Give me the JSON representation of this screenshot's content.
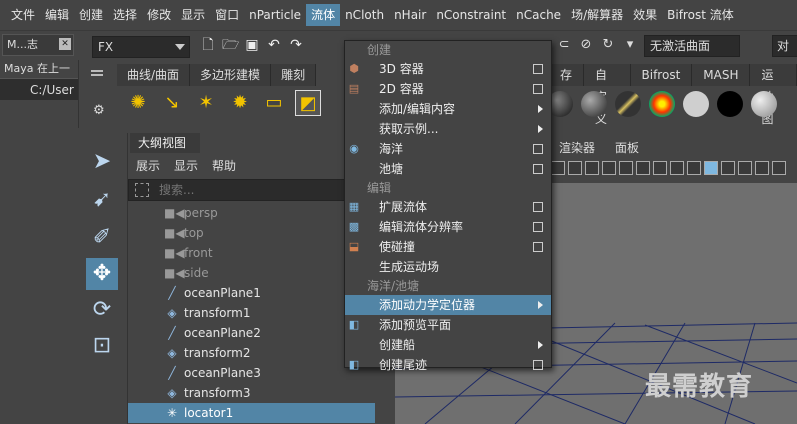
{
  "menubar": {
    "items": [
      "文件",
      "编辑",
      "创建",
      "选择",
      "修改",
      "显示",
      "窗口",
      "nParticle",
      "流体",
      "nCloth",
      "nHair",
      "nConstraint",
      "nCache",
      "场/解算器",
      "效果",
      "Bifrost 流体"
    ]
  },
  "toolbar": {
    "window_tab": "M...志",
    "mode_select": "FX",
    "surface_field": "无激活曲面",
    "right_field": "对"
  },
  "leftpane": {
    "row1": "Maya 在上一",
    "row2": "C:/User"
  },
  "shelf": {
    "tabs": [
      "曲线/曲面",
      "多边形建模",
      "雕刻"
    ],
    "tabs_right": [
      "存",
      "自定义",
      "Bifrost",
      "MASH",
      "运动图"
    ]
  },
  "outliner": {
    "title": "大纲视图",
    "menus": [
      "展示",
      "显示",
      "帮助"
    ],
    "search_placeholder": "搜索...",
    "items": [
      {
        "label": "persp",
        "icon": "camera-icon"
      },
      {
        "label": "top",
        "icon": "camera-icon"
      },
      {
        "label": "front",
        "icon": "camera-icon"
      },
      {
        "label": "side",
        "icon": "camera-icon"
      },
      {
        "label": "oceanPlane1",
        "icon": "ocean-plane-icon"
      },
      {
        "label": "transform1",
        "icon": "transform-icon"
      },
      {
        "label": "oceanPlane2",
        "icon": "ocean-plane-icon"
      },
      {
        "label": "transform2",
        "icon": "transform-icon"
      },
      {
        "label": "oceanPlane3",
        "icon": "ocean-plane-icon"
      },
      {
        "label": "transform3",
        "icon": "transform-icon"
      },
      {
        "label": "locator1",
        "icon": "locator-icon"
      }
    ]
  },
  "viewport": {
    "menus": [
      "渲染器",
      "面板"
    ]
  },
  "dropdown": {
    "section_create": "创建",
    "section_edit": "编辑",
    "section_ocean": "海洋/池塘",
    "items": {
      "container3d": "3D 容器",
      "container2d": "2D 容器",
      "add_edit_content": "添加/编辑内容",
      "get_example": "获取示例...",
      "ocean": "海洋",
      "pond": "池塘",
      "extend_fluid": "扩展流体",
      "edit_fluid_resolution": "编辑流体分辨率",
      "make_collide": "使碰撞",
      "make_motion_field": "生成运动场",
      "add_dynamic_locator": "添加动力学定位器",
      "add_preview_plane": "添加预览平面",
      "create_boat": "创建船",
      "create_wake": "创建尾迹"
    }
  },
  "watermark": "最需教育",
  "colors": {
    "accent": "#5285a6",
    "background": "#444444",
    "viewport": "#6f6f6f"
  }
}
